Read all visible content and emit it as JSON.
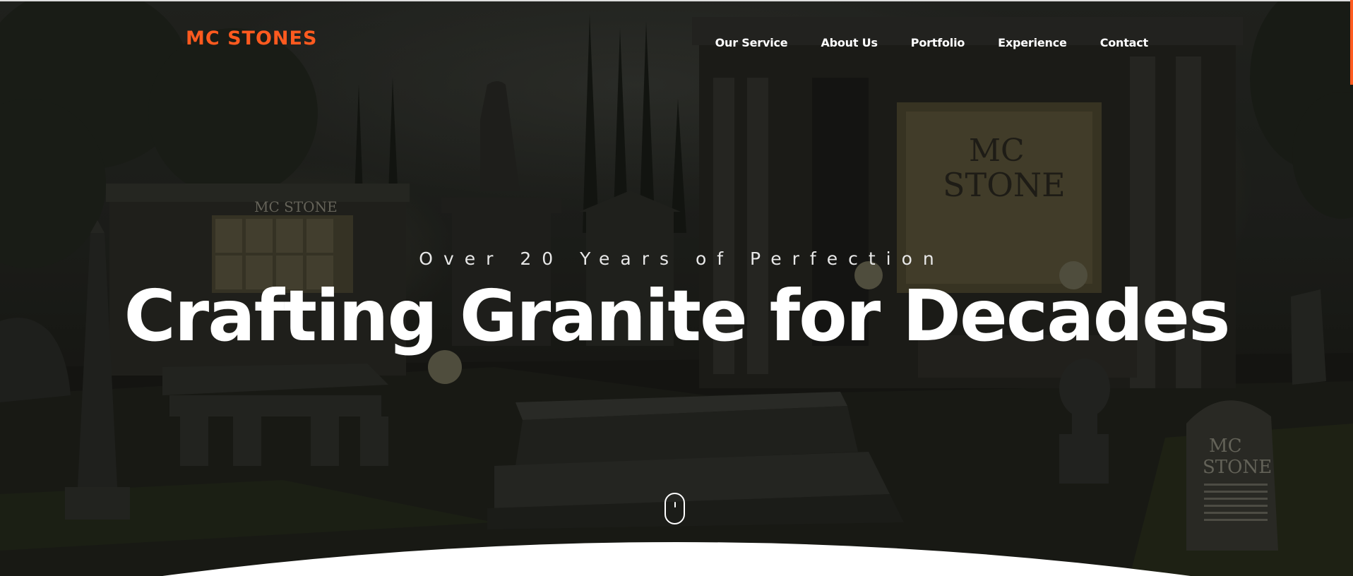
{
  "brand": {
    "name": "MC STONES",
    "color": "#ff5a1f"
  },
  "nav": {
    "items": [
      {
        "label": "Our Service"
      },
      {
        "label": "About Us"
      },
      {
        "label": "Portfolio"
      },
      {
        "label": "Experience"
      },
      {
        "label": "Contact"
      }
    ]
  },
  "hero": {
    "kicker": "Over 20 Years of Perfection",
    "headline": "Crafting Granite for Decades",
    "background_image_text": "MC STONE",
    "scroll_icon": "mouse-scroll-icon"
  },
  "colors": {
    "accent": "#ff5a1f",
    "text": "#ffffff",
    "background": "#1b1c17"
  }
}
